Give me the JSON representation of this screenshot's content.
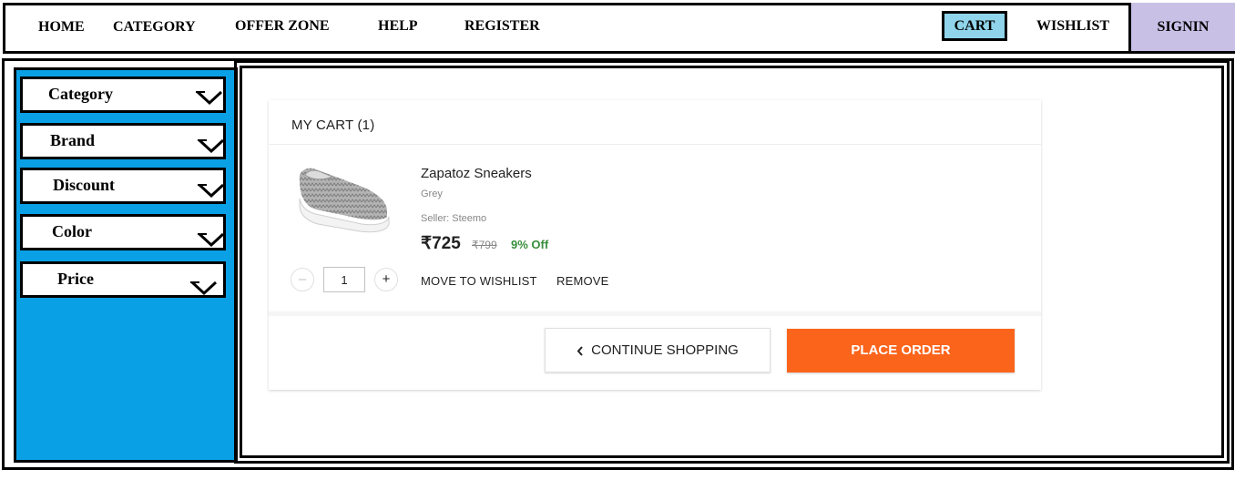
{
  "nav": {
    "home": "HOME",
    "category": "CATEGORY",
    "offer_zone": "OFFER ZONE",
    "help": "HELP",
    "register": "REGISTER",
    "cart": "CART",
    "wishlist": "WISHLIST",
    "signin": "SIGNIN"
  },
  "filters": [
    "Category",
    "Brand",
    "Discount",
    "Color",
    "Price"
  ],
  "cart": {
    "title": "MY CART (1)",
    "item": {
      "name": "Zapatoz Sneakers",
      "color": "Grey",
      "seller": "Seller: Steemo",
      "price": "₹725",
      "mrp": "₹799",
      "discount": "9% Off",
      "quantity": "1",
      "minus": "–",
      "plus": "+",
      "move_to_wishlist": "MOVE TO WISHLIST",
      "remove": "REMOVE"
    },
    "continue_shopping": "CONTINUE SHOPPING",
    "place_order": "PLACE ORDER"
  },
  "colors": {
    "cart_highlight": "#8fd4ea",
    "signin_bg": "#c9c0e6",
    "sidebar_bg": "#0aa0e6",
    "place_order_bg": "#fb641b",
    "discount_green": "#388e3c"
  },
  "icons": {
    "filter_chevron": "chevron-down-icon",
    "continue_chevron": "chevron-left-icon"
  }
}
